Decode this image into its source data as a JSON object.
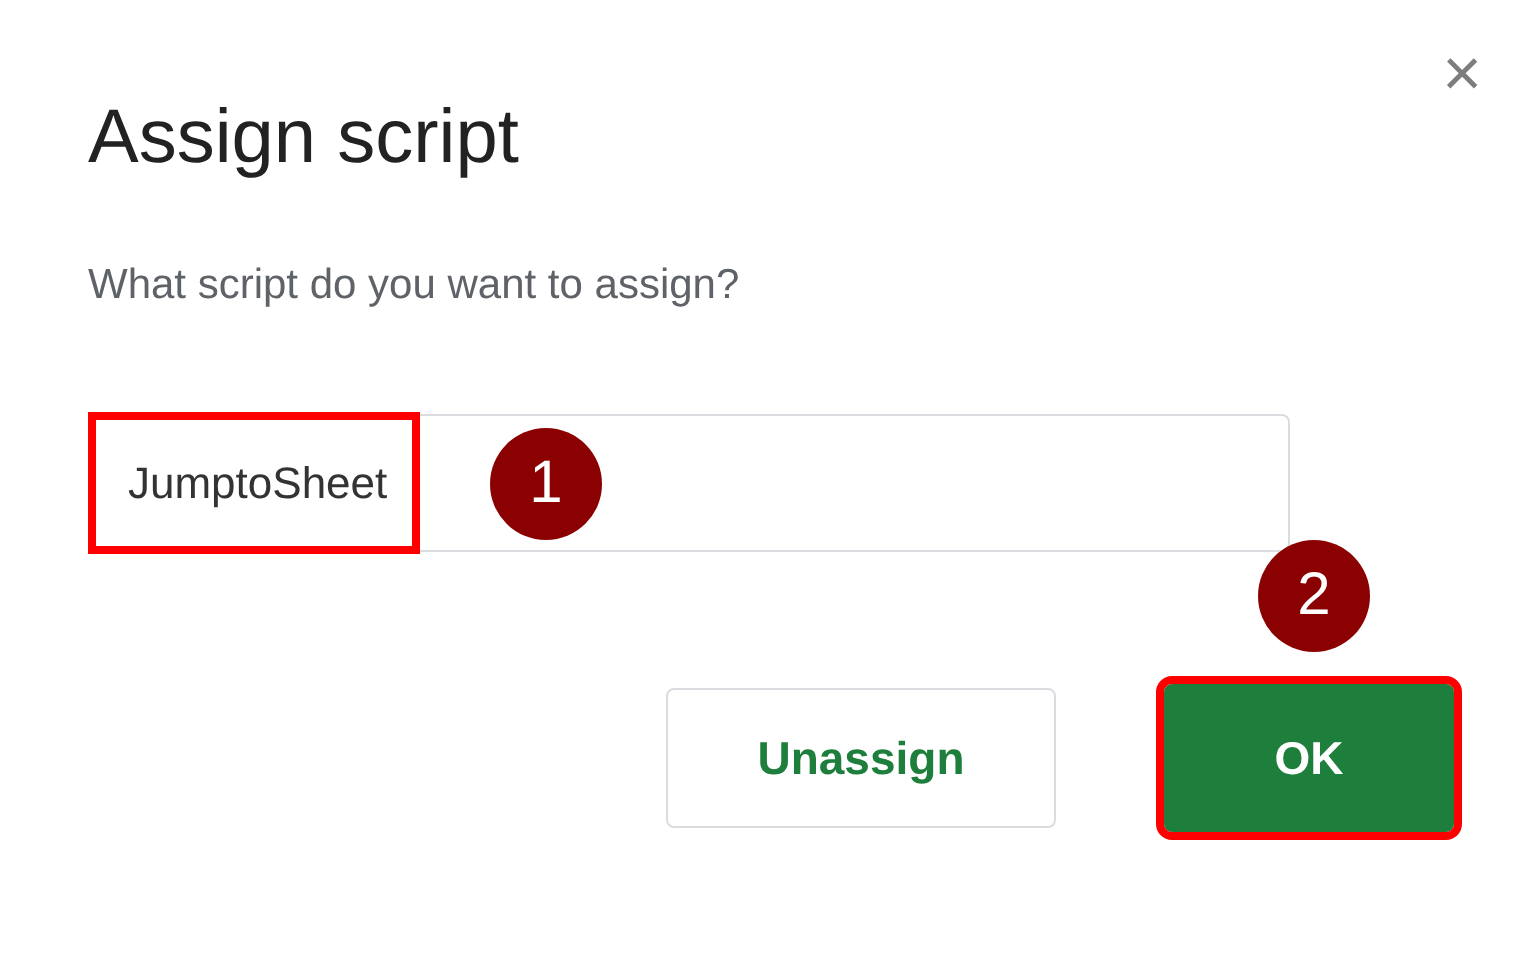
{
  "dialog": {
    "title": "Assign script",
    "close_icon": "×",
    "prompt": "What script do you want to assign?"
  },
  "field": {
    "value": "JumptoSheet",
    "highlighted": true,
    "badge": "1"
  },
  "buttons": [
    {
      "label": "Unassign",
      "kind": "secondary",
      "highlighted": false
    },
    {
      "label": "OK",
      "kind": "primary",
      "highlighted": true,
      "badge": "2"
    }
  ]
}
